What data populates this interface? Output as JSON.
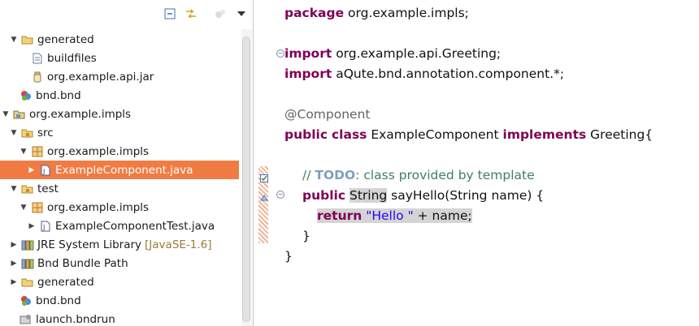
{
  "explorer": {
    "toolbar": {
      "collapse_icon": "collapse-all-icon",
      "link_icon": "link-with-editor-icon",
      "filter_icon": "filter-icon",
      "menu_icon": "view-menu-icon"
    },
    "items": [
      {
        "label": "generated",
        "icon": "folder-open-icon",
        "twisty": "expanded"
      },
      {
        "label": "buildfiles",
        "icon": "file-icon",
        "twisty": "none"
      },
      {
        "label": "org.example.api.jar",
        "icon": "jar-icon",
        "twisty": "none"
      },
      {
        "label": "bnd.bnd",
        "icon": "bnd-file-icon",
        "twisty": "none"
      },
      {
        "label": "org.example.impls",
        "icon": "project-icon",
        "twisty": "expanded"
      },
      {
        "label": "src",
        "icon": "source-folder-icon",
        "twisty": "expanded"
      },
      {
        "label": "org.example.impls",
        "icon": "package-icon",
        "twisty": "expanded"
      },
      {
        "label": "ExampleComponent.java",
        "icon": "java-file-icon",
        "twisty": "collapsed",
        "selected": true
      },
      {
        "label": "test",
        "icon": "source-folder-icon",
        "twisty": "expanded"
      },
      {
        "label": "org.example.impls",
        "icon": "package-icon",
        "twisty": "expanded"
      },
      {
        "label": "ExampleComponentTest.java",
        "icon": "java-file-icon",
        "twisty": "collapsed"
      },
      {
        "label": "JRE System Library",
        "decoration": "[JavaSE-1.6]",
        "icon": "library-icon",
        "twisty": "collapsed"
      },
      {
        "label": "Bnd Bundle Path",
        "icon": "library-icon",
        "twisty": "collapsed"
      },
      {
        "label": "generated",
        "icon": "folder-icon",
        "twisty": "collapsed"
      },
      {
        "label": "bnd.bnd",
        "icon": "bnd-file-icon",
        "twisty": "none"
      },
      {
        "label": "launch.bndrun",
        "icon": "launch-icon",
        "twisty": "none"
      }
    ]
  },
  "editor": {
    "lines": {
      "l1_kw": "package",
      "l1_rest": " org.example.impls;",
      "l3_kw": "import",
      "l3_rest": " org.example.api.Greeting;",
      "l4_kw": "import",
      "l4_rest": " aQute.bnd.annotation.component.*;",
      "l6_ann": "@Component",
      "l7_kw1": "public",
      "l7_kw2": "class",
      "l7_mid": " ExampleComponent ",
      "l7_kw3": "implements",
      "l7_rest": " Greeting{",
      "l9_cmt1": "// ",
      "l9_todo": "TODO",
      "l9_cmt2": ": class provided by template",
      "l10_kw": "public",
      "l10_type": "String",
      "l10_rest": " sayHello(String name) {",
      "l11_kw": "return",
      "l11_str": "\"Hello \"",
      "l11_rest": " + name;",
      "l12": "}",
      "l13": "}"
    },
    "markers": {
      "task_icon": "task-marker-icon",
      "override_icon": "implements-marker-icon"
    }
  }
}
